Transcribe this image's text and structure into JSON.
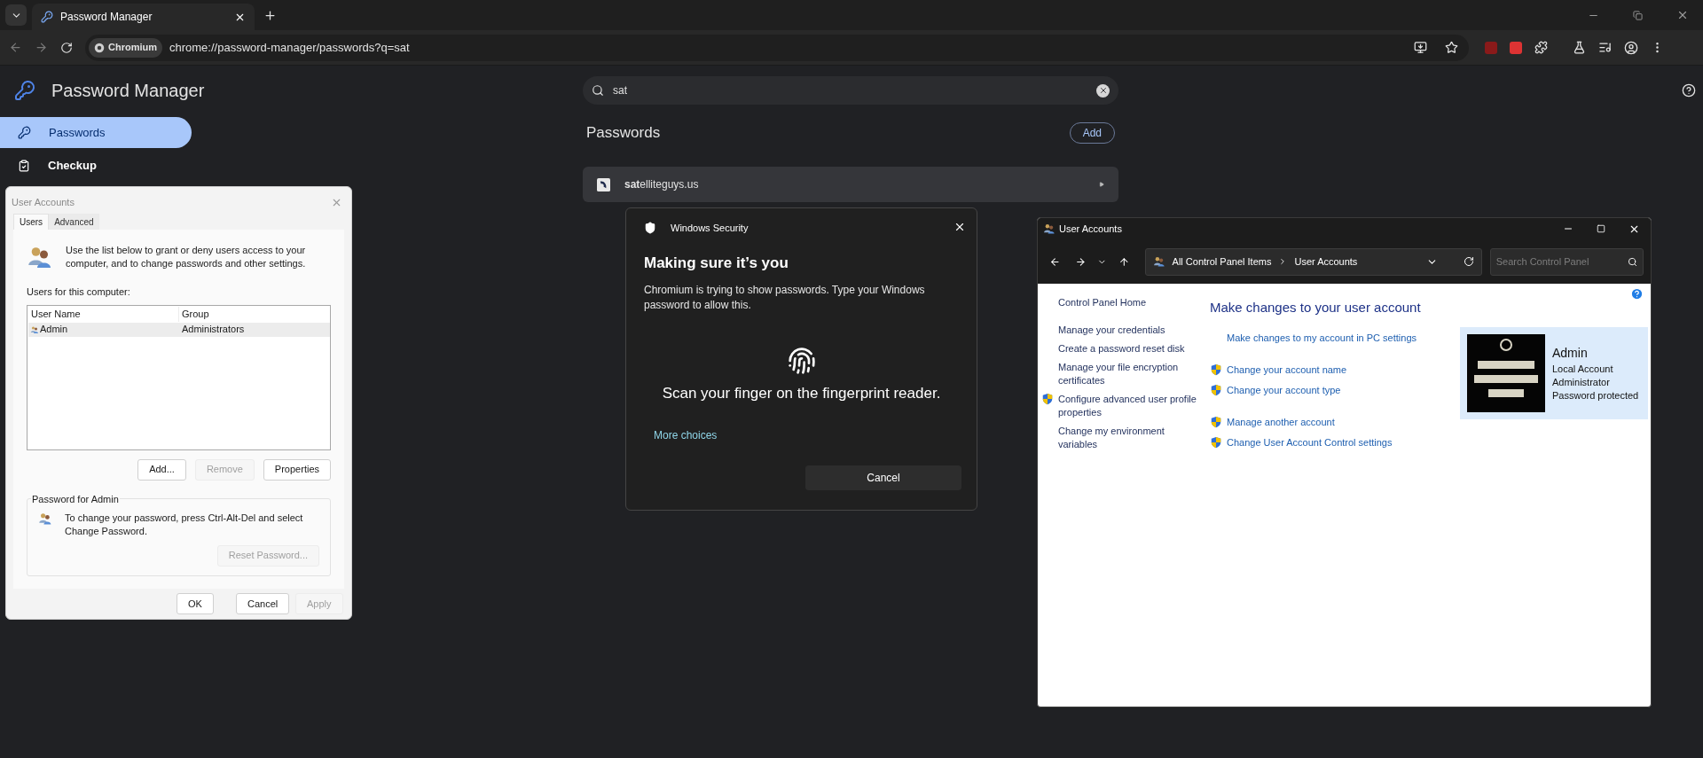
{
  "browser": {
    "tabs": [
      {
        "title": "Password Manager",
        "selected": true
      }
    ],
    "address": {
      "badge": "Chromium",
      "url": "chrome://password-manager/passwords?q=sat"
    }
  },
  "app": {
    "title": "Password Manager",
    "nav": [
      {
        "label": "Passwords",
        "selected": true
      },
      {
        "label": "Checkup",
        "selected": false
      }
    ],
    "search": {
      "value": "sat"
    },
    "section_title": "Passwords",
    "add_button": "Add",
    "entries": [
      {
        "site": "**sat**elliteguys.us"
      }
    ]
  },
  "user_accounts_dialog": {
    "title": "User Accounts",
    "tabs": [
      {
        "label": "Users",
        "selected": true
      },
      {
        "label": "Advanced",
        "selected": false
      }
    ],
    "intro": "Use the list below to grant or deny users access to your computer, and to change passwords and other settings.",
    "list_label": "Users for this computer:",
    "columns": [
      "User Name",
      "Group"
    ],
    "rows": [
      {
        "name": "Admin",
        "group": "Administrators",
        "selected": true
      }
    ],
    "list_buttons": [
      {
        "label": "Add...",
        "disabled": false
      },
      {
        "label": "Remove",
        "disabled": true
      },
      {
        "label": "Properties",
        "disabled": false
      }
    ],
    "password_group": {
      "title": "Password for Admin",
      "text": "To change your password, press Ctrl-Alt-Del and select Change Password.",
      "button": {
        "label": "Reset Password...",
        "disabled": true
      }
    },
    "footer_buttons": [
      {
        "label": "OK",
        "disabled": false
      },
      {
        "label": "Cancel",
        "disabled": false
      },
      {
        "label": "Apply",
        "disabled": true
      }
    ]
  },
  "windows_security": {
    "header": "Windows Security",
    "title": "Making sure it’s you",
    "body": "Chromium is trying to show passwords. Type your Windows password to allow this.",
    "prompt": "Scan your finger on the fingerprint reader.",
    "link": "More choices",
    "button": "Cancel"
  },
  "control_panel": {
    "title": "User Accounts",
    "breadcrumb": [
      "All Control Panel Items",
      "User Accounts"
    ],
    "search": {
      "placeholder": "Search Control Panel"
    },
    "links": [
      {
        "label": "Control Panel Home",
        "shield": false
      },
      {
        "label": "Manage your credentials",
        "shield": false
      },
      {
        "label": "Create a password reset disk",
        "shield": false
      },
      {
        "label": "Manage your file encryption certificates",
        "shield": false
      },
      {
        "label": "Configure advanced user profile properties",
        "shield": true
      },
      {
        "label": "Change my environment variables",
        "shield": false
      }
    ],
    "heading": "Make changes to your user account",
    "task_groups": [
      {
        "tasks": [
          {
            "label": "Make changes to my account in PC settings",
            "shield": false
          }
        ]
      },
      {
        "tasks": [
          {
            "label": "Change your account name",
            "shield": true
          },
          {
            "label": "Change your account type",
            "shield": true
          }
        ]
      },
      {
        "tasks": [
          {
            "label": "Manage another account",
            "shield": true
          },
          {
            "label": "Change User Account Control settings",
            "shield": true
          }
        ]
      }
    ],
    "account": {
      "name": "Admin",
      "details": [
        "Local Account",
        "Administrator",
        "Password protected"
      ]
    }
  }
}
